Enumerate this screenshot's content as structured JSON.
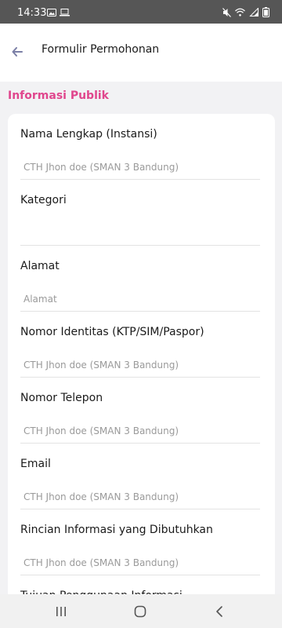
{
  "status_bar": {
    "time": "14:33",
    "left_icons": [
      "image-icon",
      "laptop-icon"
    ],
    "right_icons": [
      "mute-icon",
      "wifi-icon",
      "signal-icon",
      "battery-icon"
    ]
  },
  "header": {
    "title": "Formulir Permohonan",
    "back_icon": "arrow-left-icon"
  },
  "section": {
    "title": "Informasi Publik"
  },
  "form": {
    "fields": [
      {
        "label": "Nama Lengkap (Instansi)",
        "placeholder": "CTH Jhon doe (SMAN 3 Bandung)"
      },
      {
        "label": "Kategori",
        "placeholder": ""
      },
      {
        "label": "Alamat",
        "placeholder": "Alamat"
      },
      {
        "label": "Nomor Identitas (KTP/SIM/Paspor)",
        "placeholder": "CTH Jhon doe (SMAN 3 Bandung)"
      },
      {
        "label": "Nomor Telepon",
        "placeholder": "CTH Jhon doe (SMAN 3 Bandung)"
      },
      {
        "label": "Email",
        "placeholder": "CTH Jhon doe (SMAN 3 Bandung)"
      },
      {
        "label": "Rincian Informasi yang Dibutuhkan",
        "placeholder": "CTH Jhon doe (SMAN 3 Bandung)"
      },
      {
        "label": "Tujuan Penggunaan Informasi",
        "placeholder": ""
      }
    ]
  },
  "nav_bar": {
    "icons": [
      "recent-apps-icon",
      "home-icon",
      "back-icon"
    ]
  },
  "colors": {
    "accent": "#e0468d",
    "status_bar": "#565656",
    "page_background": "#f2f2f4",
    "back_arrow": "#7b7fa6"
  }
}
